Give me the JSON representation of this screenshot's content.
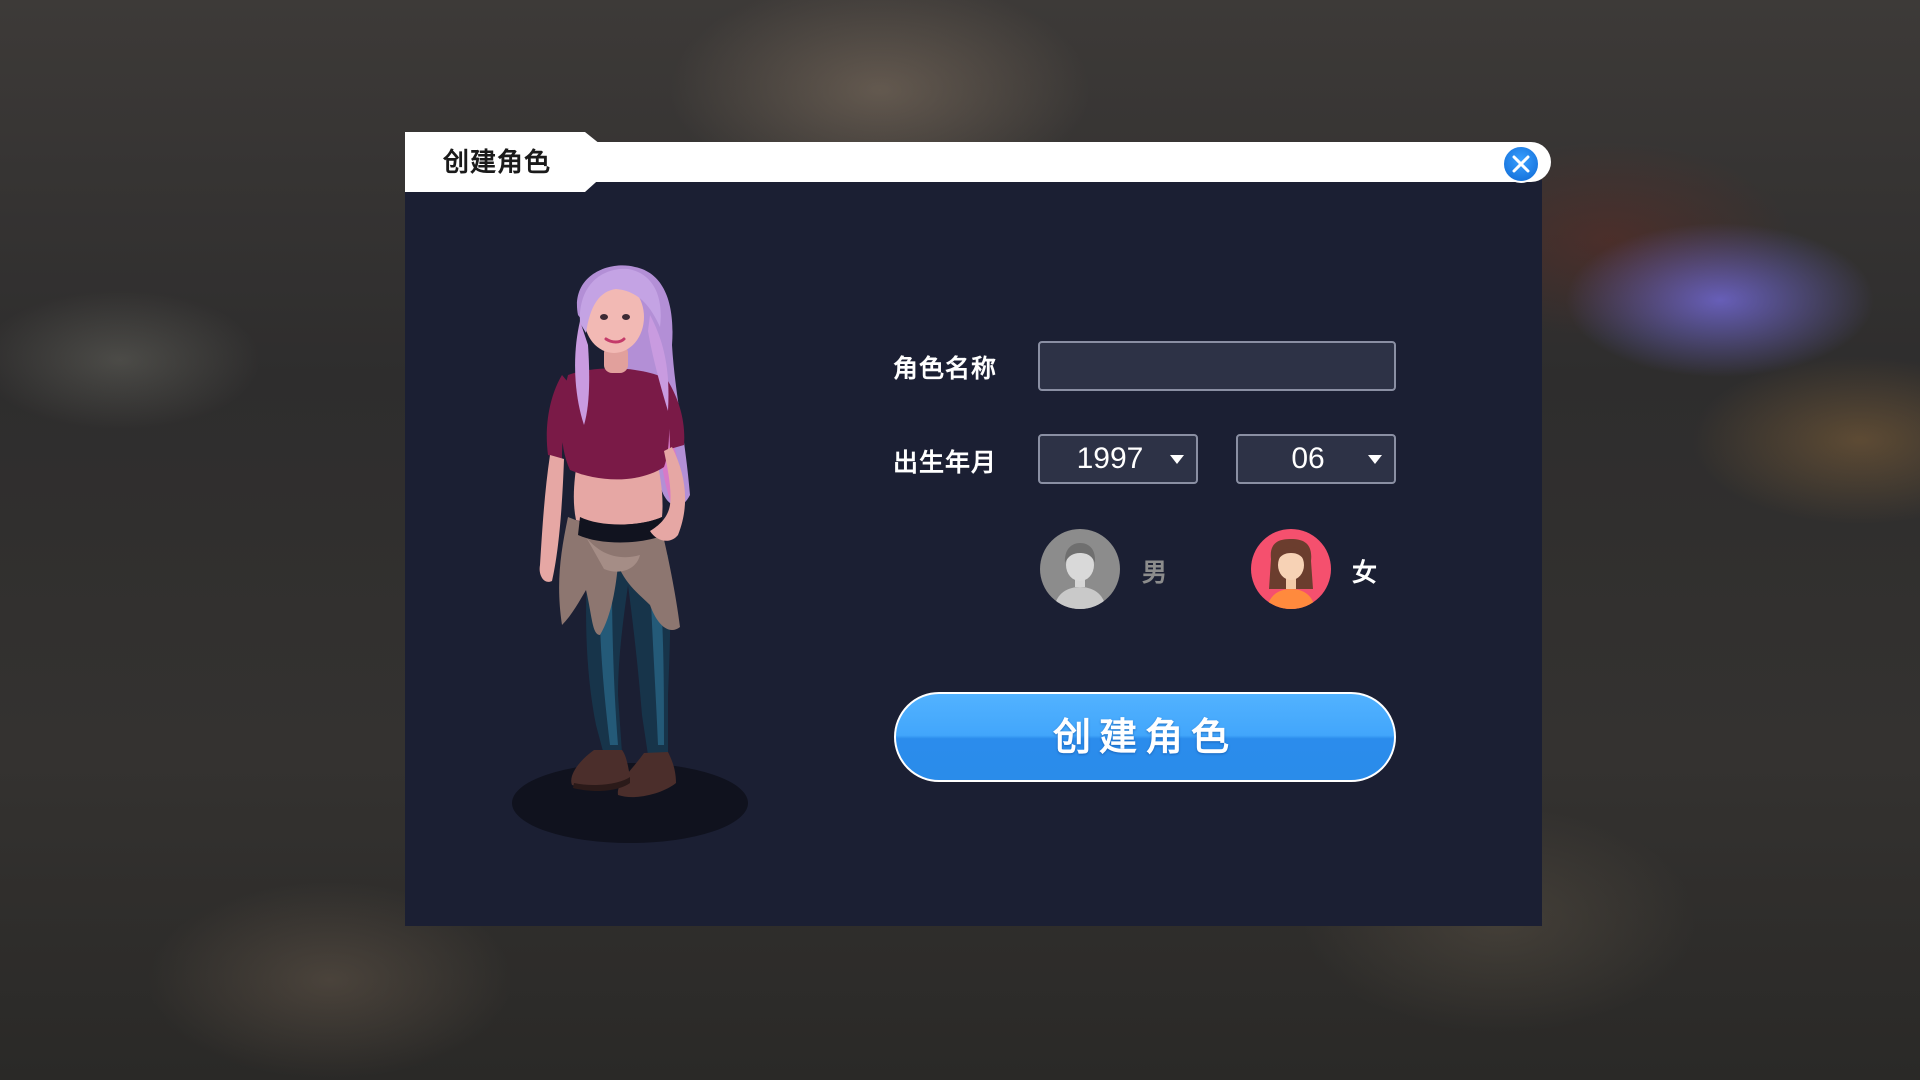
{
  "dialog": {
    "title": "创建角色",
    "close_icon": "close-icon"
  },
  "form": {
    "name_label": "角色名称",
    "name_value": "",
    "birth_label": "出生年月",
    "birth_year": "1997",
    "birth_month": "06"
  },
  "gender": {
    "male_label": "男",
    "female_label": "女",
    "selected": "female",
    "male_icon": "male-avatar-icon",
    "female_icon": "female-avatar-icon"
  },
  "create_button_label": "创建角色",
  "colors": {
    "panel": "#1b1f33",
    "accent": "#42a6fb",
    "female_accent": "#f5506e",
    "male_inactive": "#8c8c8c"
  }
}
